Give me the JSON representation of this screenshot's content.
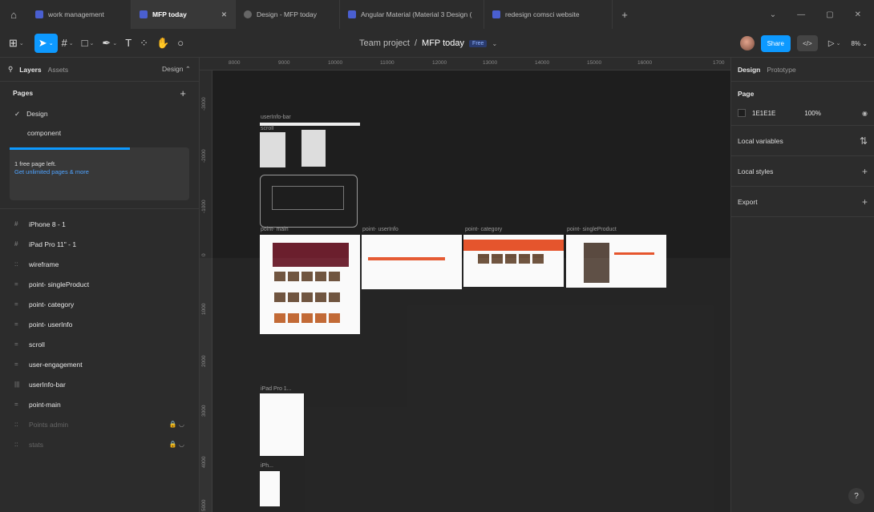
{
  "tabs": [
    {
      "label": "work management",
      "active": false,
      "icon": "figma-file-icon"
    },
    {
      "label": "MFP today",
      "active": true,
      "icon": "figma-file-icon"
    },
    {
      "label": "Design - MFP today",
      "active": false,
      "icon": "figma-proto-icon"
    },
    {
      "label": "Angular Material (Material 3 Design (",
      "active": false,
      "icon": "figma-file-icon"
    },
    {
      "label": "redesign comsci website",
      "active": false,
      "icon": "figma-file-icon"
    }
  ],
  "toolbar": {
    "project": "Team project",
    "separator": "/",
    "file": "MFP today",
    "plan_badge": "Free",
    "share_label": "Share",
    "dev_label": "</>",
    "zoom": "8%"
  },
  "left": {
    "tab_layers": "Layers",
    "tab_assets": "Assets",
    "design_select": "Design",
    "pages_header": "Pages",
    "pages": [
      {
        "name": "Design",
        "current": true
      },
      {
        "name": "component",
        "current": false
      }
    ],
    "free_notice": "1 free page left.",
    "free_link": "Get unlimited pages & more",
    "layers": [
      {
        "name": "iPhone 8 - 1",
        "icon": "#",
        "dim": false
      },
      {
        "name": "iPad Pro 11\" - 1",
        "icon": "#",
        "dim": false
      },
      {
        "name": "wireframe",
        "icon": "::",
        "dim": false
      },
      {
        "name": "point- singleProduct",
        "icon": "=",
        "dim": false
      },
      {
        "name": "point- category",
        "icon": "=",
        "dim": false
      },
      {
        "name": "point- userInfo",
        "icon": "=",
        "dim": false
      },
      {
        "name": "scroll",
        "icon": "=",
        "dim": false
      },
      {
        "name": "user-engagement",
        "icon": "=",
        "dim": false
      },
      {
        "name": "userInfo-bar",
        "icon": "|||",
        "dim": false
      },
      {
        "name": "point-main",
        "icon": "=",
        "dim": false
      },
      {
        "name": "Points admin",
        "icon": "::",
        "dim": true
      },
      {
        "name": "stats",
        "icon": "::",
        "dim": true
      }
    ]
  },
  "right": {
    "tab_design": "Design",
    "tab_prototype": "Prototype",
    "page_header": "Page",
    "bg_color": "1E1E1E",
    "bg_opacity": "100%",
    "local_variables": "Local variables",
    "local_styles": "Local styles",
    "export": "Export",
    "help": "?"
  },
  "canvas": {
    "ruler_top": [
      "8000",
      "9000",
      "10000",
      "11000",
      "12000",
      "13000",
      "14000",
      "15000",
      "16000",
      "1700"
    ],
    "ruler_left": [
      "-3000",
      "-2000",
      "-1000",
      "0",
      "1000",
      "2000",
      "3000",
      "4000",
      "5000"
    ],
    "frames": [
      {
        "label": "userInfo-bar"
      },
      {
        "label": "scroll"
      },
      {
        "label": "point- main"
      },
      {
        "label": "point- userInfo"
      },
      {
        "label": "point- category"
      },
      {
        "label": "point- singleProduct"
      },
      {
        "label": "iPad Pro 1..."
      },
      {
        "label": "iPh..."
      }
    ]
  }
}
